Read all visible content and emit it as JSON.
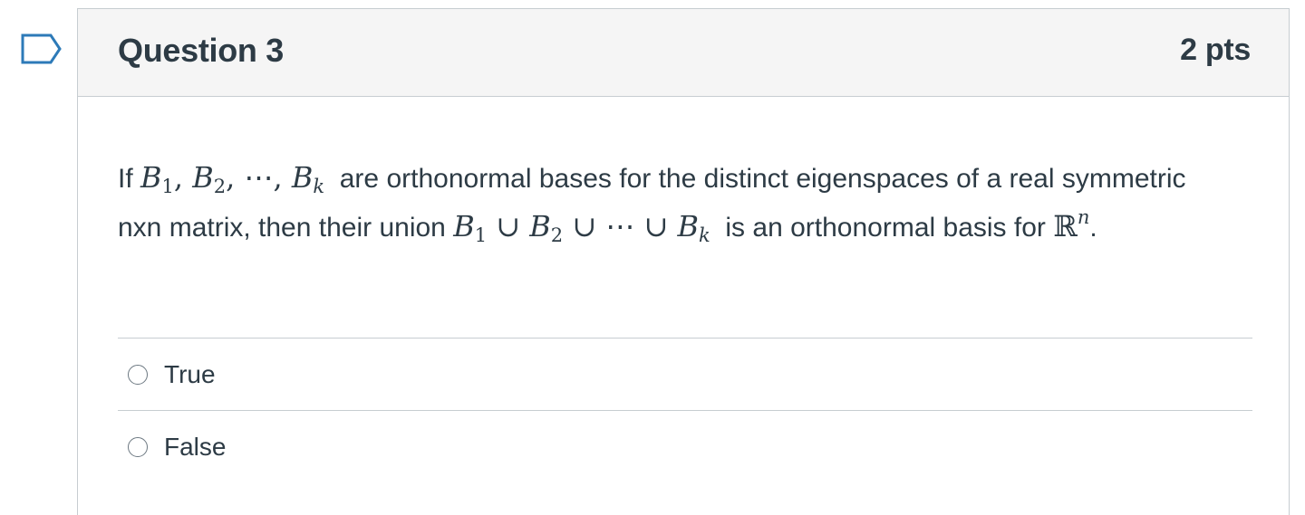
{
  "question": {
    "title": "Question 3",
    "points": "2 pts",
    "text": {
      "prefix": "If",
      "math1": {
        "b1": "B",
        "sub1": "1",
        "comma1": ",",
        "b2": "B",
        "sub2": "2",
        "comma2": ",",
        "dots": "⋯",
        "comma3": ",",
        "bk": "B",
        "subk": "k"
      },
      "middle1": "are orthonormal bases for the distinct eigenspaces of a real symmetric nxn matrix, then their union",
      "math2": {
        "b1": "B",
        "sub1": "1",
        "cup1": "∪",
        "b2": "B",
        "sub2": "2",
        "cup2": "∪",
        "dots": "⋯",
        "cup3": "∪",
        "bk": "B",
        "subk": "k"
      },
      "middle2": "is an orthonormal basis for",
      "math3": {
        "r": "ℝ",
        "sup": "n"
      },
      "suffix": "."
    },
    "answers": [
      {
        "label": "True"
      },
      {
        "label": "False"
      }
    ]
  },
  "colors": {
    "text": "#2d3b45",
    "border": "#c7cdd1",
    "header_bg": "#f5f5f5",
    "flag": "#2d7ab8"
  },
  "icons": {
    "flag": "flag-question-icon",
    "radio": "radio-unchecked-icon"
  }
}
